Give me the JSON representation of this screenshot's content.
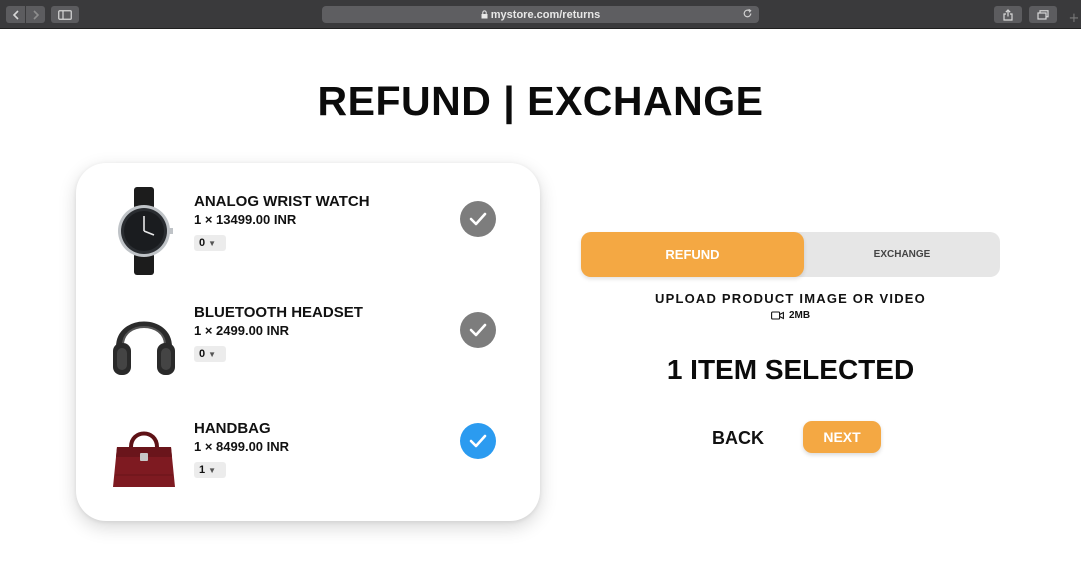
{
  "browser": {
    "url": "mystore.com/returns",
    "new_tab_label": "+"
  },
  "page": {
    "title": "REFUND | EXCHANGE"
  },
  "items": [
    {
      "name": "ANALOG WRIST WATCH",
      "price": "1 × 13499.00 INR",
      "quantity": "0",
      "selected": false,
      "image": "wrist-watch"
    },
    {
      "name": "BLUETOOTH HEADSET",
      "price": "1 × 2499.00 INR",
      "quantity": "0",
      "selected": false,
      "image": "headphones"
    },
    {
      "name": "HANDBAG",
      "price": "1 × 8499.00 INR",
      "quantity": "1",
      "selected": true,
      "image": "handbag"
    }
  ],
  "toggle": {
    "refund_label": "REFUND",
    "exchange_label": "EXCHANGE",
    "active": "refund"
  },
  "upload": {
    "label": "UPLOAD PRODUCT IMAGE OR VIDEO",
    "size_limit": "2MB",
    "icon": "video-camera-icon"
  },
  "selection": {
    "summary": "1 ITEM SELECTED"
  },
  "actions": {
    "back_label": "BACK",
    "next_label": "NEXT"
  },
  "colors": {
    "accent": "#f4a843",
    "check_selected": "#2b9bf0",
    "check_unselected": "#7d7d7d",
    "toggle_bg": "#e6e6e6"
  }
}
